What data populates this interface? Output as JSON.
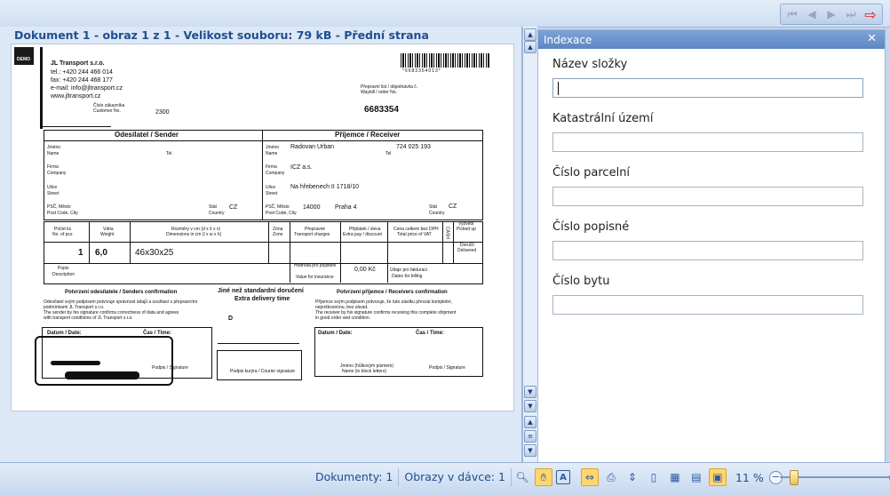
{
  "viewer": {
    "title": "Dokument 1 - obraz 1 z 1 - Velikost souboru: 79 kB - Přední strana"
  },
  "document": {
    "logo_text": "DEMO",
    "sender_company": "JL Transport s.r.o.",
    "sender_tel": "tel.: +420 244 466 014",
    "sender_fax": "fax: +420 244 468 177",
    "sender_email": "e-mail: info@jltransport.cz",
    "sender_web": "www.jltransport.cz",
    "customer_label": "Číslo zákazníka",
    "customer_label_en": "Customer No.",
    "customer_no": "2300",
    "barcode_text": "*6683354013*",
    "waybill_label": "Přepravní list / objednávka č.",
    "waybill_label_en": "Waybill / order No.",
    "waybill_no": "6683354",
    "sender_header": "Odesílatel / Sender",
    "receiver_header": "Příjemce / Receiver",
    "name_label": "Jméno",
    "name_label_en": "Name",
    "tel_label": "Tel.",
    "firm_label": "Firma",
    "firm_label_en": "Company",
    "street_label": "Ulice",
    "street_label_en": "Street",
    "psc_label": "PSČ, Město",
    "psc_label_en": "Post Code, City",
    "state_label": "Stát",
    "state_label_en": "Country",
    "sender_country": "CZ",
    "receiver_name": "Radovan Urban",
    "receiver_phone": "724 025 193",
    "receiver_company": "ICZ a.s.",
    "receiver_street": "Na hřebenech II 1718/10",
    "receiver_postcode": "14000",
    "receiver_city": "Praha 4",
    "receiver_country": "CZ",
    "col_pcs": "Počet ks",
    "col_pcs_en": "No. of pcs",
    "col_weight": "Váha",
    "col_weight_en": "Weight",
    "col_dims": "Rozměry v cm (d x š x v)",
    "col_dims_en": "Dimensions in cm (l x w x h)",
    "col_zone": "Zóna",
    "col_zone_en": "Zone",
    "col_charges": "Přepravné",
    "col_charges_en": "Transport charges",
    "col_extra": "Příplatek / sleva",
    "col_extra_en": "Extra pay / discount",
    "col_total": "Cena celkem bez DPH",
    "col_total_en": "Total price of VAT",
    "col_cash": "CASH",
    "col_pickup": "Vyzvedl",
    "col_pickup_en": "Picked up",
    "col_delivered": "Doručil",
    "col_delivered_en": "Delivered",
    "pcs_value": "1",
    "weight_value": "6,0",
    "dims_value": "46x30x25",
    "desc_label": "Popis",
    "desc_label_en": "Description",
    "insurance_label": "Hodnota pro pojištění",
    "insurance_label_en": "Value for insurance",
    "insurance_value": "0,00 Kč",
    "billing_label": "Údaje pro fakturaci",
    "billing_label_en": "Dates for billing",
    "sender_confirm_title": "Potvrzení odesílatele / Senders confirmation",
    "sender_confirm_text1": "Odesílatel svým podpisem potvrzuje správnost údajů a souhlasí s přepravními",
    "sender_confirm_text2": "podmínkami JL Transport s.r.o.",
    "sender_confirm_text3": "The sender by his signature confirms correctness of data and agrees",
    "sender_confirm_text4": "with transport conditions of JL Transport s.r.o.",
    "other_title": "Jiné než standardní doručení",
    "other_title_en": "Extra delivery time",
    "other_d": "D",
    "receiver_confirm_title": "Potvrzení příjemce / Receivers confirmation",
    "receiver_confirm_text1": "Příjemce svým podpisem potvrzuje, že tuto zásilku převzal kompletní,",
    "receiver_confirm_text2": "nepoškozenou, bez závad.",
    "receiver_confirm_text3": "The receiver by his signature confirms receiving this complete shipment",
    "receiver_confirm_text4": "in good order and condition.",
    "date_label": "Datum / Date:",
    "time_label": "Čas / Time:",
    "signature_label": "Podpis / Signature",
    "courier_sig_label": "Podpis kurýra / Courier signature",
    "name_block_label": "Jméno (hůlkovým písmem)",
    "name_block_label_en": "Name (in block letters)"
  },
  "panel": {
    "title": "Indexace",
    "close_icon": "close-icon",
    "fields": [
      {
        "label": "Název složky",
        "value": ""
      },
      {
        "label": "Katastrální území",
        "value": ""
      },
      {
        "label": "Číslo parcelní",
        "value": ""
      },
      {
        "label": "Číslo popisné",
        "value": ""
      },
      {
        "label": "Číslo bytu",
        "value": ""
      }
    ]
  },
  "status": {
    "documents": "Dokumenty: 1",
    "images_in_batch": "Obrazy v dávce: 1",
    "zoom": "11 %",
    "zoom_fraction": 0.12
  },
  "nav": {
    "icons": [
      "first-icon",
      "previous-icon",
      "next-icon",
      "last-icon",
      "exit-icon"
    ]
  },
  "colors": {
    "accent": "#1f4f8f",
    "panel_header": "#6a92cd",
    "active_nav": "#e01818"
  }
}
